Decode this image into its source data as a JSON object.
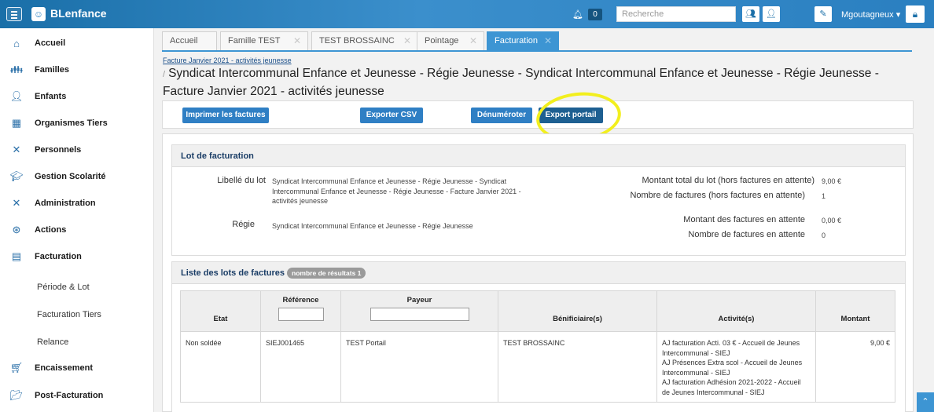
{
  "topbar": {
    "brand": "BLenfance",
    "bell_count": "0",
    "search_placeholder": "Recherche",
    "user": "Mgoutagneux"
  },
  "sidebar": {
    "items": [
      {
        "label": "Accueil",
        "icon": "home-icon"
      },
      {
        "label": "Familles",
        "icon": "family-icon"
      },
      {
        "label": "Enfants",
        "icon": "child-icon"
      },
      {
        "label": "Organismes Tiers",
        "icon": "building-icon"
      },
      {
        "label": "Personnels",
        "icon": "tools-icon"
      },
      {
        "label": "Gestion Scolarité",
        "icon": "graduation-cap-icon"
      },
      {
        "label": "Administration",
        "icon": "wrench-icon"
      },
      {
        "label": "Actions",
        "icon": "settings-circle-icon"
      },
      {
        "label": "Facturation",
        "icon": "invoice-icon"
      }
    ],
    "sub_items": [
      "Période & Lot",
      "Facturation Tiers",
      "Relance"
    ],
    "bottom_items": [
      {
        "label": "Encaissement",
        "icon": "cart-icon"
      },
      {
        "label": "Post-Facturation",
        "icon": "folder-icon"
      }
    ]
  },
  "tabs": [
    {
      "label": "Accueil"
    },
    {
      "label": "Famille TEST"
    },
    {
      "label": "TEST BROSSAINC"
    },
    {
      "label": "Pointage"
    },
    {
      "label": "Facturation"
    }
  ],
  "breadcrumb": "Facture Janvier 2021 - activités jeunesse",
  "page_title": "Syndicat Intercommunal Enfance et Jeunesse - Régie Jeunesse - Syndicat Intercommunal Enfance et Jeunesse - Régie Jeunesse - Facture Janvier 2021 - activités jeunesse",
  "toolbar": {
    "print": "Imprimer les factures",
    "export_csv": "Exporter CSV",
    "denumber": "Dénuméroter",
    "export_portal": "Export portail"
  },
  "lot": {
    "heading": "Lot de facturation",
    "libelle_label": "Libellé du lot",
    "libelle_value": "Syndicat Intercommunal Enfance et Jeunesse - Régie Jeunesse - Syndicat Intercommunal Enfance et Jeunesse - Régie Jeunesse - Facture Janvier 2021 - activités jeunesse",
    "regie_label": "Régie",
    "regie_value": "Syndicat Intercommunal Enfance et Jeunesse - Régie Jeunesse",
    "total_label": "Montant total du lot (hors factures en attente)",
    "total_value": "9,00 €",
    "count_label": "Nombre de factures (hors factures en attente)",
    "count_value": "1",
    "pending_amount_label": "Montant des factures en attente",
    "pending_amount_value": "0,00 €",
    "pending_count_label": "Nombre de factures en attente",
    "pending_count_value": "0"
  },
  "list": {
    "heading": "Liste des lots de factures",
    "badge": "nombre de résultats 1",
    "columns": {
      "etat": "Etat",
      "reference": "Référence",
      "payeur": "Payeur",
      "beneficiaires": "Bénificiaire(s)",
      "activites": "Activité(s)",
      "montant": "Montant"
    },
    "rows": [
      {
        "etat": "Non soldée",
        "reference": "SIEJ001465",
        "payeur": "TEST Portail",
        "beneficiaires": "TEST BROSSAINC",
        "activites": "AJ facturation Acti. 03 € - Accueil de Jeunes Intercommunal - SIEJ\nAJ Présences Extra scol - Accueil de Jeunes Intercommunal - SIEJ\nAJ facturation Adhésion 2021-2022 - Accueil de Jeunes Intercommunal - SIEJ",
        "montant": "9,00 €"
      }
    ]
  },
  "colors": {
    "accent": "#3d95d3",
    "button": "#2f7fc4",
    "highlight": "#f2ef1e"
  }
}
